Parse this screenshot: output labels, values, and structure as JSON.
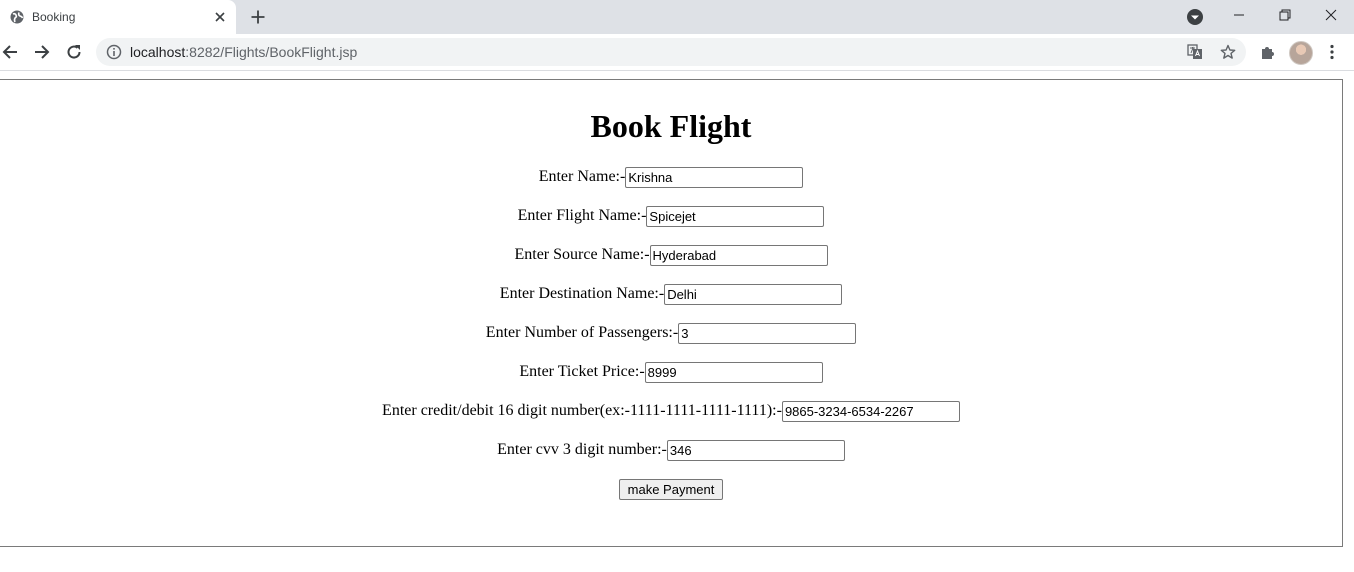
{
  "browser": {
    "tab": {
      "title": "Booking"
    },
    "address": {
      "host": "localhost",
      "rest": ":8282/Flights/BookFlight.jsp"
    }
  },
  "page": {
    "heading": "Book Flight",
    "fields": [
      {
        "label": "Enter Name:-",
        "value": "Krishna"
      },
      {
        "label": "Enter Flight Name:-",
        "value": "Spicejet"
      },
      {
        "label": "Enter Source Name:-",
        "value": "Hyderabad"
      },
      {
        "label": "Enter Destination Name:-",
        "value": "Delhi"
      },
      {
        "label": "Enter Number of Passengers:-",
        "value": "3"
      },
      {
        "label": "Enter Ticket Price:-",
        "value": "8999"
      },
      {
        "label": "Enter credit/debit 16 digit number(ex:-1111-1111-1111-1111):-",
        "value": "9865-3234-6534-2267"
      },
      {
        "label": "Enter cvv 3 digit number:-",
        "value": "346"
      }
    ],
    "submit_label": "make Payment"
  }
}
